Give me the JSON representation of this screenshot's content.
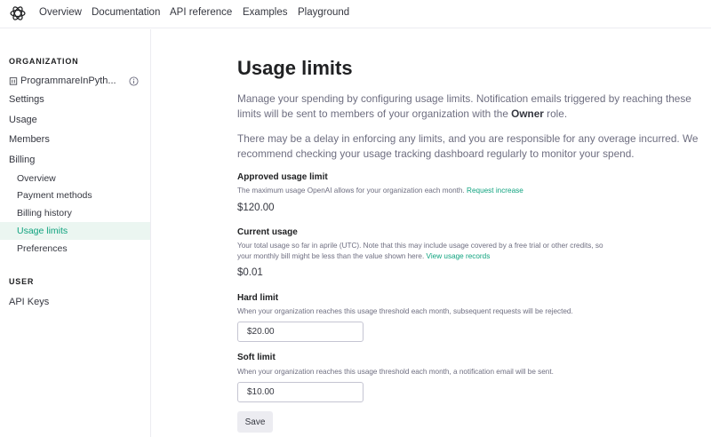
{
  "nav": {
    "items": [
      "Overview",
      "Documentation",
      "API reference",
      "Examples",
      "Playground"
    ]
  },
  "sidebar": {
    "org_heading": "ORGANIZATION",
    "org_name": "ProgrammareInPyth...",
    "items": [
      "Settings",
      "Usage",
      "Members",
      "Billing"
    ],
    "billing_items": [
      "Overview",
      "Payment methods",
      "Billing history",
      "Usage limits",
      "Preferences"
    ],
    "active_item": "Usage limits",
    "user_heading": "USER",
    "user_items": [
      "API Keys"
    ]
  },
  "main": {
    "title": "Usage limits",
    "intro_1": "Manage your spending by configuring usage limits. Notification emails triggered by reaching these limits will be sent to members of your organization with the ",
    "intro_1_bold": "Owner",
    "intro_1_end": " role.",
    "intro_2": "There may be a delay in enforcing any limits, and you are responsible for any overage incurred. We recommend checking your usage tracking dashboard regularly to monitor your spend.",
    "approved": {
      "title": "Approved usage limit",
      "desc": "The maximum usage OpenAI allows for your organization each month. ",
      "link": "Request increase",
      "value": "$120.00"
    },
    "current": {
      "title": "Current usage",
      "desc": "Your total usage so far in aprile (UTC). Note that this may include usage covered by a free trial or other credits, so your monthly bill might be less than the value shown here. ",
      "link": "View usage records",
      "value": "$0.01"
    },
    "hard": {
      "title": "Hard limit",
      "desc": "When your organization reaches this usage threshold each month, subsequent requests will be rejected.",
      "value": "$20.00"
    },
    "soft": {
      "title": "Soft limit",
      "desc": "When your organization reaches this usage threshold each month, a notification email will be sent.",
      "value": "$10.00"
    },
    "save_label": "Save"
  },
  "colors": {
    "accent": "#10a37f",
    "active_bg": "#ebf6f1",
    "text": "#353740",
    "muted": "#6e6e80"
  },
  "icons": [
    "openai-logo-icon",
    "building-icon",
    "info-icon"
  ]
}
